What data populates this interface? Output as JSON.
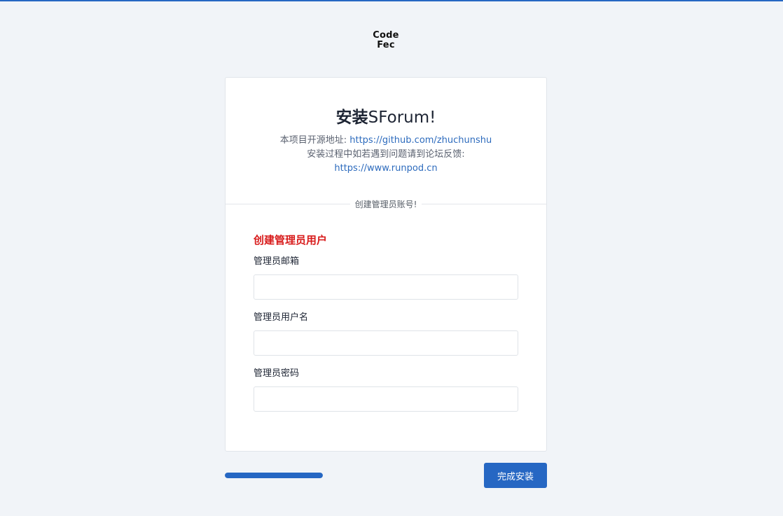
{
  "logo": {
    "line1": "Code",
    "line2": "Fec"
  },
  "header": {
    "title_bold": "安装",
    "title_rest": "SForum!",
    "repo_prefix": "本项目开源地址: ",
    "repo_link": "https://github.com/zhuchunshu",
    "help_text": "安装过程中如若遇到问题请到论坛反馈:",
    "forum_link": "https://www.runpod.cn"
  },
  "divider": {
    "label": "创建管理员账号!"
  },
  "form": {
    "section_title": "创建管理员用户",
    "fields": [
      {
        "label": "管理员邮箱",
        "value": "",
        "placeholder": ""
      },
      {
        "label": "管理员用户名",
        "value": "",
        "placeholder": ""
      },
      {
        "label": "管理员密码",
        "value": "",
        "placeholder": ""
      }
    ]
  },
  "footer": {
    "progress_fraction": 1.0,
    "finish_label": "完成安装"
  },
  "colors": {
    "accent": "#2667c3",
    "section_title": "#d81b1b",
    "background": "#f1f4f8"
  }
}
